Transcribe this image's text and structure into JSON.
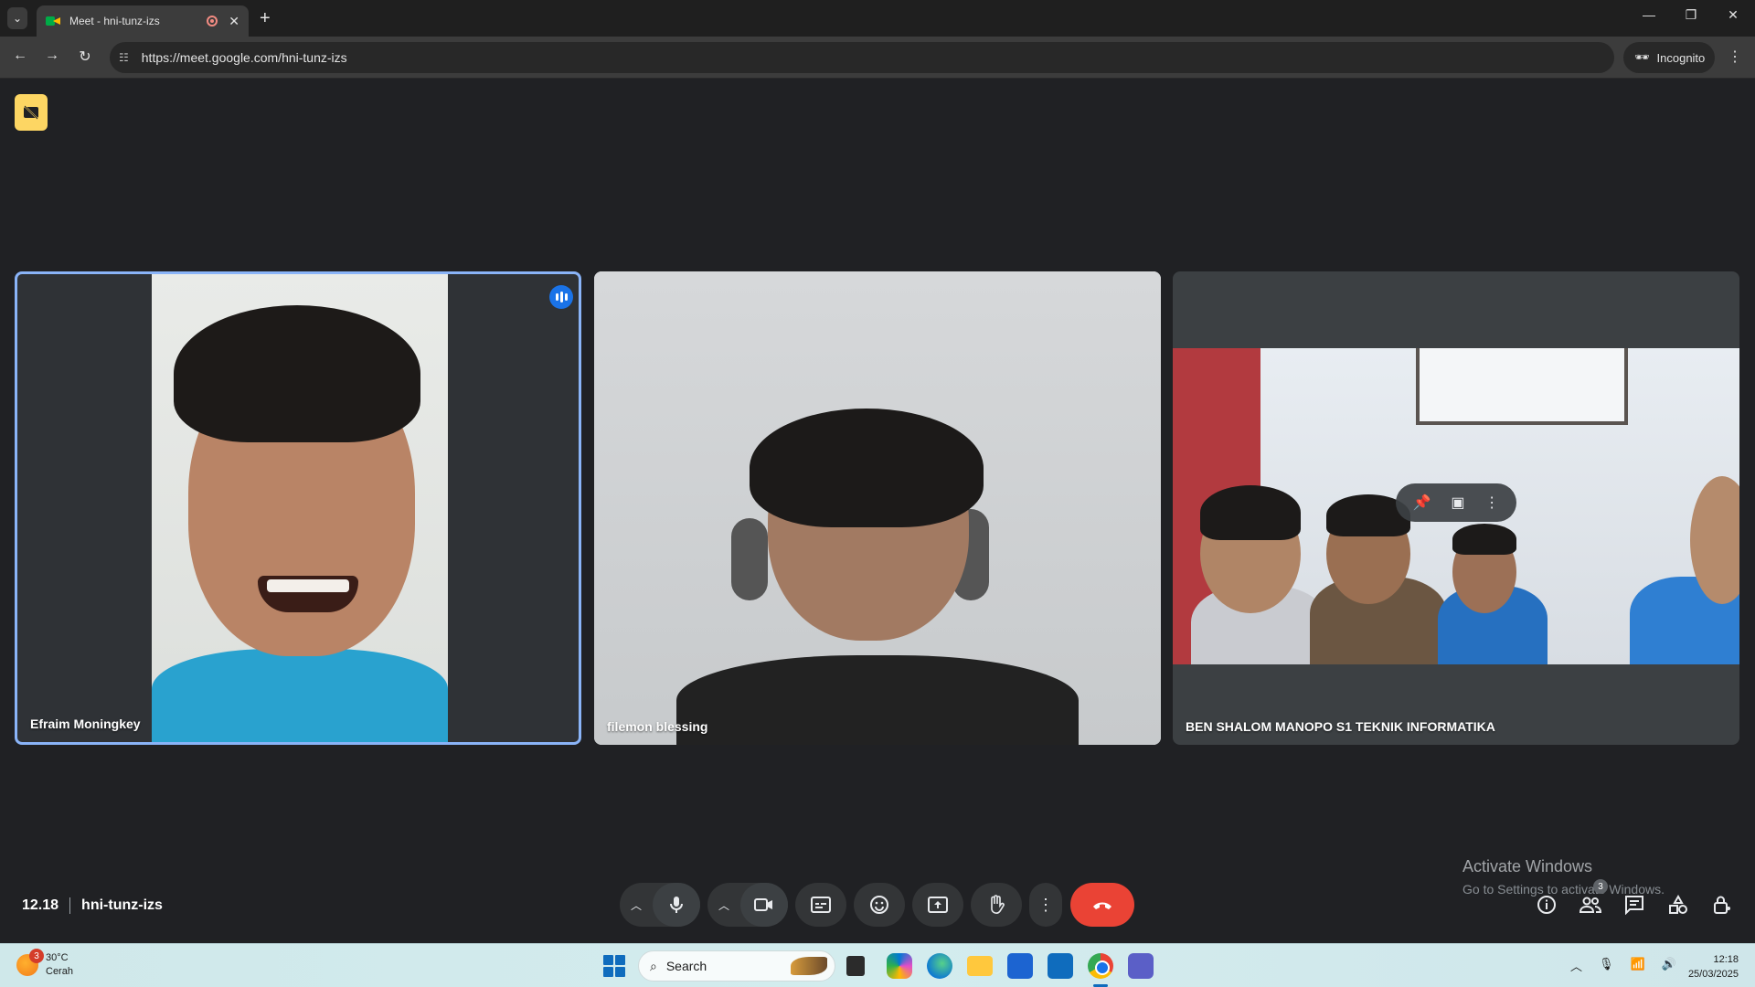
{
  "browser": {
    "tab_title": "Meet - hni-tunz-izs",
    "url": "https://meet.google.com/hni-tunz-izs",
    "incognito_label": "Incognito"
  },
  "meeting": {
    "time": "12.18",
    "code": "hni-tunz-izs",
    "participants": [
      {
        "name": "Efraim Moningkey",
        "speaking": true
      },
      {
        "name": "filemon blessing",
        "speaking": false
      },
      {
        "name": "BEN SHALOM MANOPO S1 TEKNIK INFORMATIKA",
        "speaking": false
      }
    ],
    "people_count": "3",
    "accent_color": "#8ab4f8",
    "leave_color": "#ea4335"
  },
  "watermark": {
    "line1": "Activate Windows",
    "line2": "Go to Settings to activate Windows."
  },
  "taskbar": {
    "weather_temp": "30°C",
    "weather_desc": "Cerah",
    "weather_badge": "3",
    "search_placeholder": "Search",
    "time": "12:18",
    "date": "25/03/2025"
  }
}
